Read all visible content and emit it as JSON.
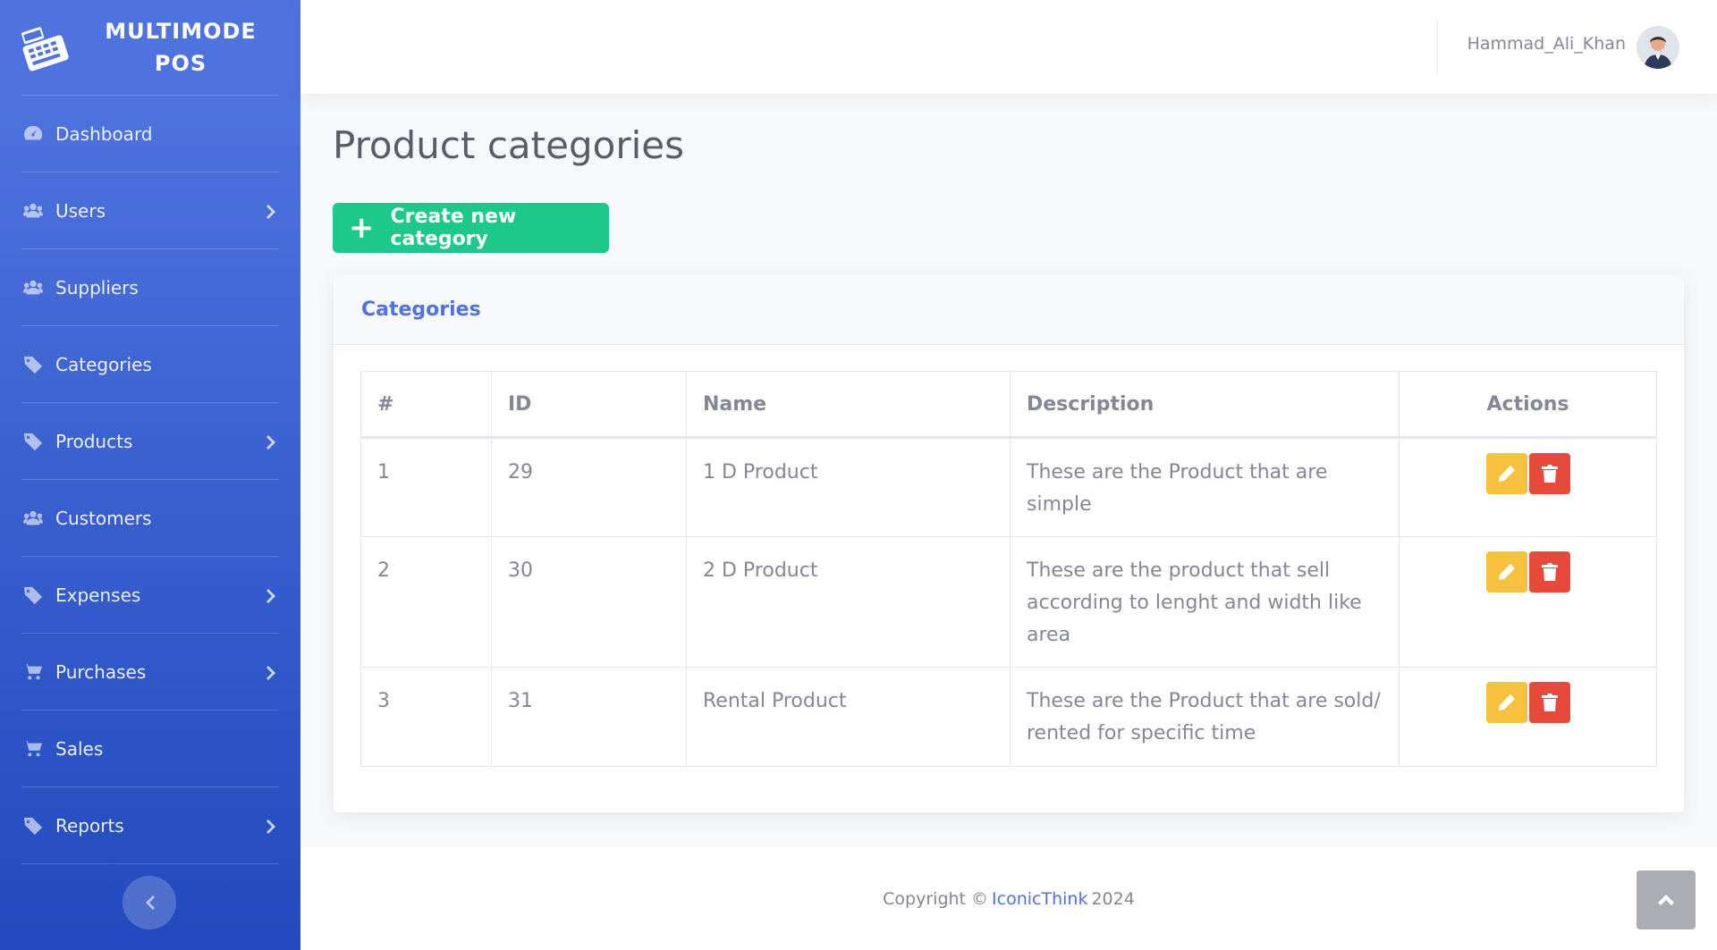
{
  "brand": {
    "line1": "MULTIMODE",
    "line2": "POS",
    "logo_icon": "cash-register-icon"
  },
  "sidebar": {
    "items": [
      {
        "label": "Dashboard",
        "icon": "tachometer-icon",
        "has_submenu": false
      },
      {
        "label": "Users",
        "icon": "users-icon",
        "has_submenu": true
      },
      {
        "label": "Suppliers",
        "icon": "users-icon",
        "has_submenu": false
      },
      {
        "label": "Categories",
        "icon": "tag-icon",
        "has_submenu": false
      },
      {
        "label": "Products",
        "icon": "tag-icon",
        "has_submenu": true
      },
      {
        "label": "Customers",
        "icon": "users-icon",
        "has_submenu": false
      },
      {
        "label": "Expenses",
        "icon": "tag-icon",
        "has_submenu": true
      },
      {
        "label": "Purchases",
        "icon": "cart-icon",
        "has_submenu": true
      },
      {
        "label": "Sales",
        "icon": "cart-icon",
        "has_submenu": false
      },
      {
        "label": "Reports",
        "icon": "tag-icon",
        "has_submenu": true
      }
    ],
    "toggle_icon": "chevron-left-icon"
  },
  "topbar": {
    "user_name": "Hammad_Ali_Khan"
  },
  "page": {
    "title": "Product categories",
    "create_button": "Create new category",
    "create_icon": "+"
  },
  "card": {
    "title": "Categories",
    "columns": [
      "#",
      "ID",
      "Name",
      "Description",
      "Actions"
    ],
    "rows": [
      {
        "num": "1",
        "id": "29",
        "name": "1 D Product",
        "description": "These are the Product that are simple"
      },
      {
        "num": "2",
        "id": "30",
        "name": "2 D Product",
        "description": "These are the product that sell according to lenght and width like area"
      },
      {
        "num": "3",
        "id": "31",
        "name": "Rental Product",
        "description": "These are the Product that are sold/ rented for specific time"
      }
    ]
  },
  "footer": {
    "prefix": "Copyright ©",
    "link": "IconicThink",
    "year": "2024"
  },
  "colors": {
    "primary": "#4e73df",
    "success": "#1cc88a",
    "warning": "#f6c23e",
    "danger": "#e74a3b"
  }
}
